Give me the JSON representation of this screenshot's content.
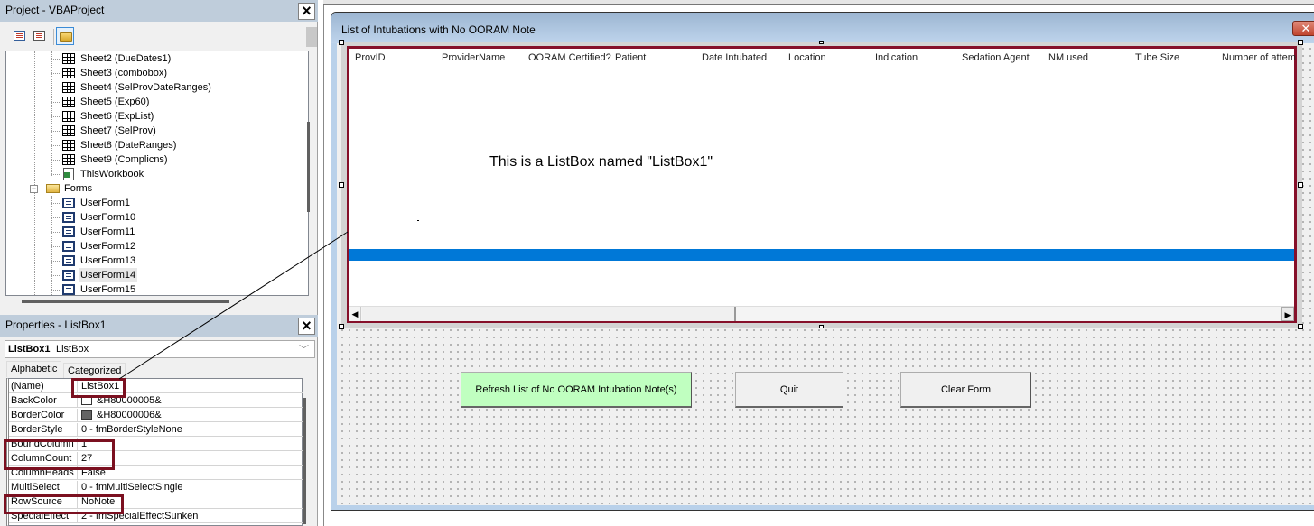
{
  "project_pane": {
    "title": "Project - VBAProject",
    "close_icon": "close-x-icon",
    "toolbar": [
      "view-code-icon",
      "view-object-icon",
      "toggle-folders-icon"
    ],
    "tree": {
      "sheets": [
        "Sheet2 (DueDates1)",
        "Sheet3 (combobox)",
        "Sheet4 (SelProvDateRanges)",
        "Sheet5 (Exp60)",
        "Sheet6 (ExpList)",
        "Sheet7 (SelProv)",
        "Sheet8 (DateRanges)",
        "Sheet9 (Complicns)"
      ],
      "workbook": "ThisWorkbook",
      "forms_folder": "Forms",
      "forms": [
        "UserForm1",
        "UserForm10",
        "UserForm11",
        "UserForm12",
        "UserForm13",
        "UserForm14",
        "UserForm15"
      ],
      "selected_form": "UserForm14"
    }
  },
  "properties_pane": {
    "title": "Properties - ListBox1",
    "object_name": "ListBox1",
    "object_type": "ListBox",
    "tabs": [
      "Alphabetic",
      "Categorized"
    ],
    "active_tab": "Alphabetic",
    "rows": [
      {
        "key": "(Name)",
        "value": "ListBox1",
        "highlighted": true
      },
      {
        "key": "BackColor",
        "value": "&H80000005&",
        "swatch": "#ffffff"
      },
      {
        "key": "BorderColor",
        "value": "&H80000006&",
        "swatch": "#646464"
      },
      {
        "key": "BorderStyle",
        "value": "0 - fmBorderStyleNone"
      },
      {
        "key": "BoundColumn",
        "value": "1",
        "highlighted": true
      },
      {
        "key": "ColumnCount",
        "value": "27",
        "highlighted": true
      },
      {
        "key": "ColumnHeads",
        "value": "False"
      },
      {
        "key": "MultiSelect",
        "value": "0 - fmMultiSelectSingle"
      },
      {
        "key": "RowSource",
        "value": "NoNote",
        "highlighted": true
      },
      {
        "key": "SpecialEffect",
        "value": "2 - fmSpecialEffectSunken"
      }
    ]
  },
  "userform": {
    "title": "List of Intubations with No OORAM Note",
    "close_icon": "close-x-icon",
    "listbox": {
      "columns": [
        "ProvID",
        "ProviderName",
        "OORAM Certified?",
        "Patient",
        "Date Intubated",
        "Location",
        "Indication",
        "Sedation Agent",
        "NM used",
        "Tube Size",
        "Number of attem"
      ],
      "annotation": "This is a ListBox named \"ListBox1\"",
      "selection_color": "#0078d7"
    },
    "buttons": {
      "refresh": "Refresh List of No OORAM Intubation Note(s)",
      "quit": "Quit",
      "clear": "Clear Form"
    },
    "colors": {
      "highlight_box": "#7b1020",
      "refresh_button_bg": "#c0ffc0",
      "title_bar": "#9cb6d2"
    }
  }
}
